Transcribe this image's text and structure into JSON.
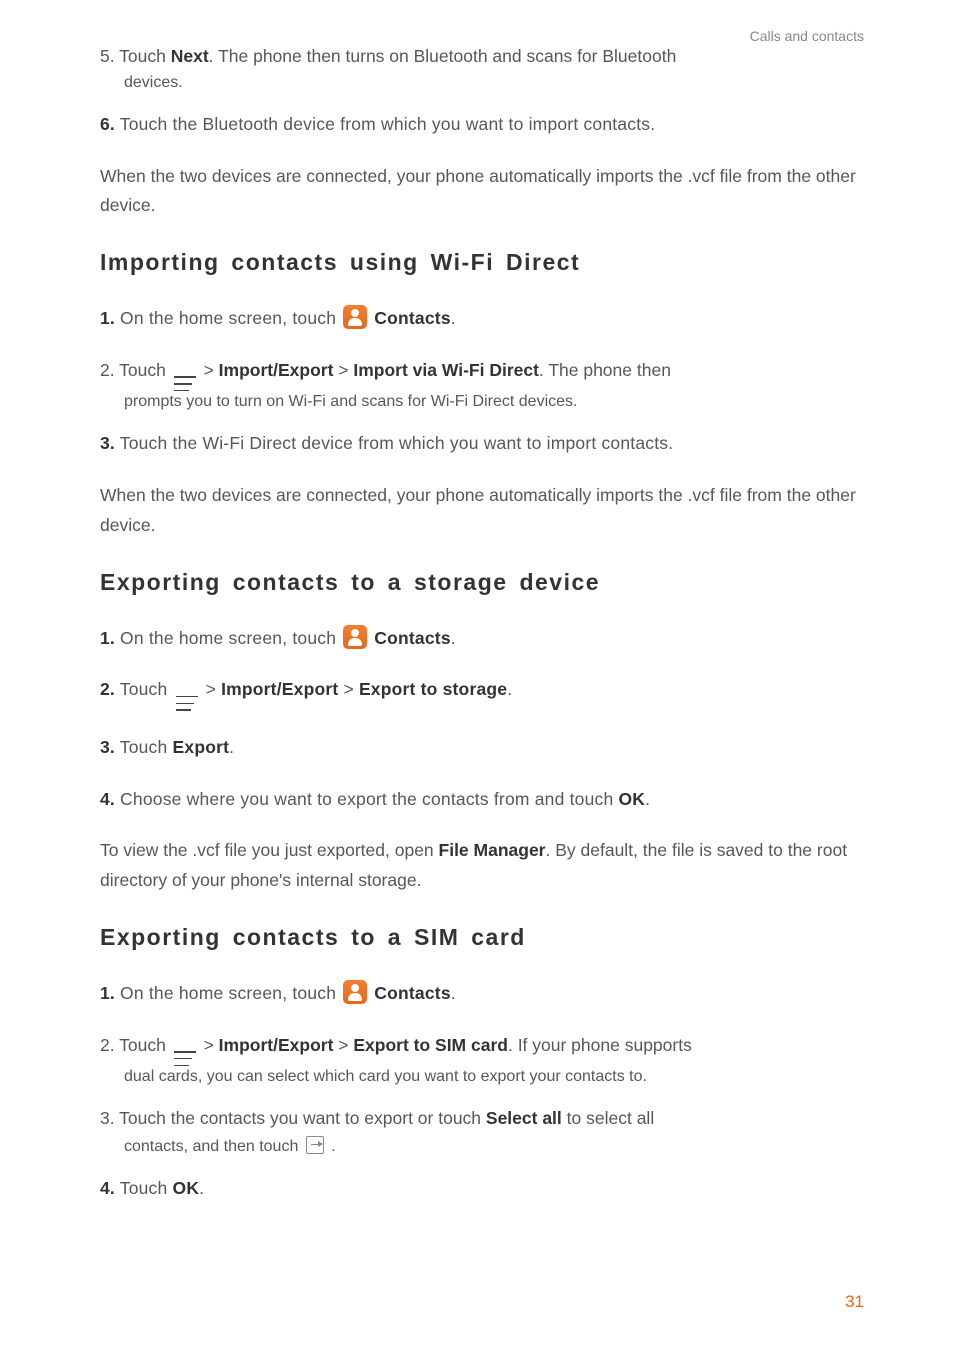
{
  "header": {
    "breadcrumb": "Calls and contacts"
  },
  "intro_steps": {
    "step5": {
      "num": "5.",
      "pre": " Touch ",
      "bold": "Next",
      "post": ". The phone then turns on Bluetooth and scans for Bluetooth",
      "indent": "devices."
    },
    "step6": {
      "num": "6.",
      "text": " Touch the Bluetooth device from which you want to import contacts."
    },
    "para": "When the two devices are connected, your phone automatically imports the .vcf file from the other device."
  },
  "section_wifidirect": {
    "title": "Importing contacts using Wi-Fi Direct",
    "step1": {
      "num": "1.",
      "pre": " On the home screen, touch ",
      "boldpost": "Contacts",
      "post": "."
    },
    "step2": {
      "num": "2.",
      "pre": " Touch ",
      "sep1": " > ",
      "b1": "Import/Export",
      "sep2": " > ",
      "b2": "Import via Wi-Fi Direct",
      "post": ". The phone then",
      "indent": "prompts you to turn on Wi-Fi and scans for Wi-Fi Direct devices."
    },
    "step3": {
      "num": "3.",
      "text": " Touch the Wi-Fi Direct device from which you want to import contacts."
    },
    "para": "When the two devices are connected, your phone automatically imports the .vcf file from the other device."
  },
  "section_export_storage": {
    "title": "Exporting contacts to a storage device",
    "step1": {
      "num": "1.",
      "pre": " On the home screen, touch ",
      "boldpost": "Contacts",
      "post": "."
    },
    "step2": {
      "num": "2.",
      "pre": " Touch ",
      "sep1": " > ",
      "b1": "Import/Export",
      "sep2": " > ",
      "b2": "Export to storage",
      "post": "."
    },
    "step3": {
      "num": "3.",
      "pre": " Touch ",
      "b1": "Export",
      "post": "."
    },
    "step4": {
      "num": "4.",
      "pre": " Choose where you want to export the contacts from and touch ",
      "b1": "OK",
      "post": "."
    },
    "para_pre": "To view the .vcf file you just exported, open ",
    "para_bold": "File Manager",
    "para_post": ". By default, the file is saved to the root directory of your phone's internal storage."
  },
  "section_export_sim": {
    "title": "Exporting contacts to a SIM card",
    "step1": {
      "num": "1.",
      "pre": " On the home screen, touch ",
      "boldpost": "Contacts",
      "post": "."
    },
    "step2": {
      "num": "2.",
      "pre": " Touch ",
      "sep1": " > ",
      "b1": "Import/Export",
      "sep2": " > ",
      "b2": "Export to SIM card",
      "post": ". If your phone supports",
      "indent": "dual cards, you can select which card you want to export your contacts to."
    },
    "step3": {
      "num": "3.",
      "pre": " Touch the contacts you want to export or touch ",
      "b1": "Select all",
      "post": " to select all",
      "indent_pre": "contacts, and then touch ",
      "indent_post": " ."
    },
    "step4": {
      "num": "4.",
      "pre": " Touch ",
      "b1": "OK",
      "post": "."
    }
  },
  "page_number": "31"
}
